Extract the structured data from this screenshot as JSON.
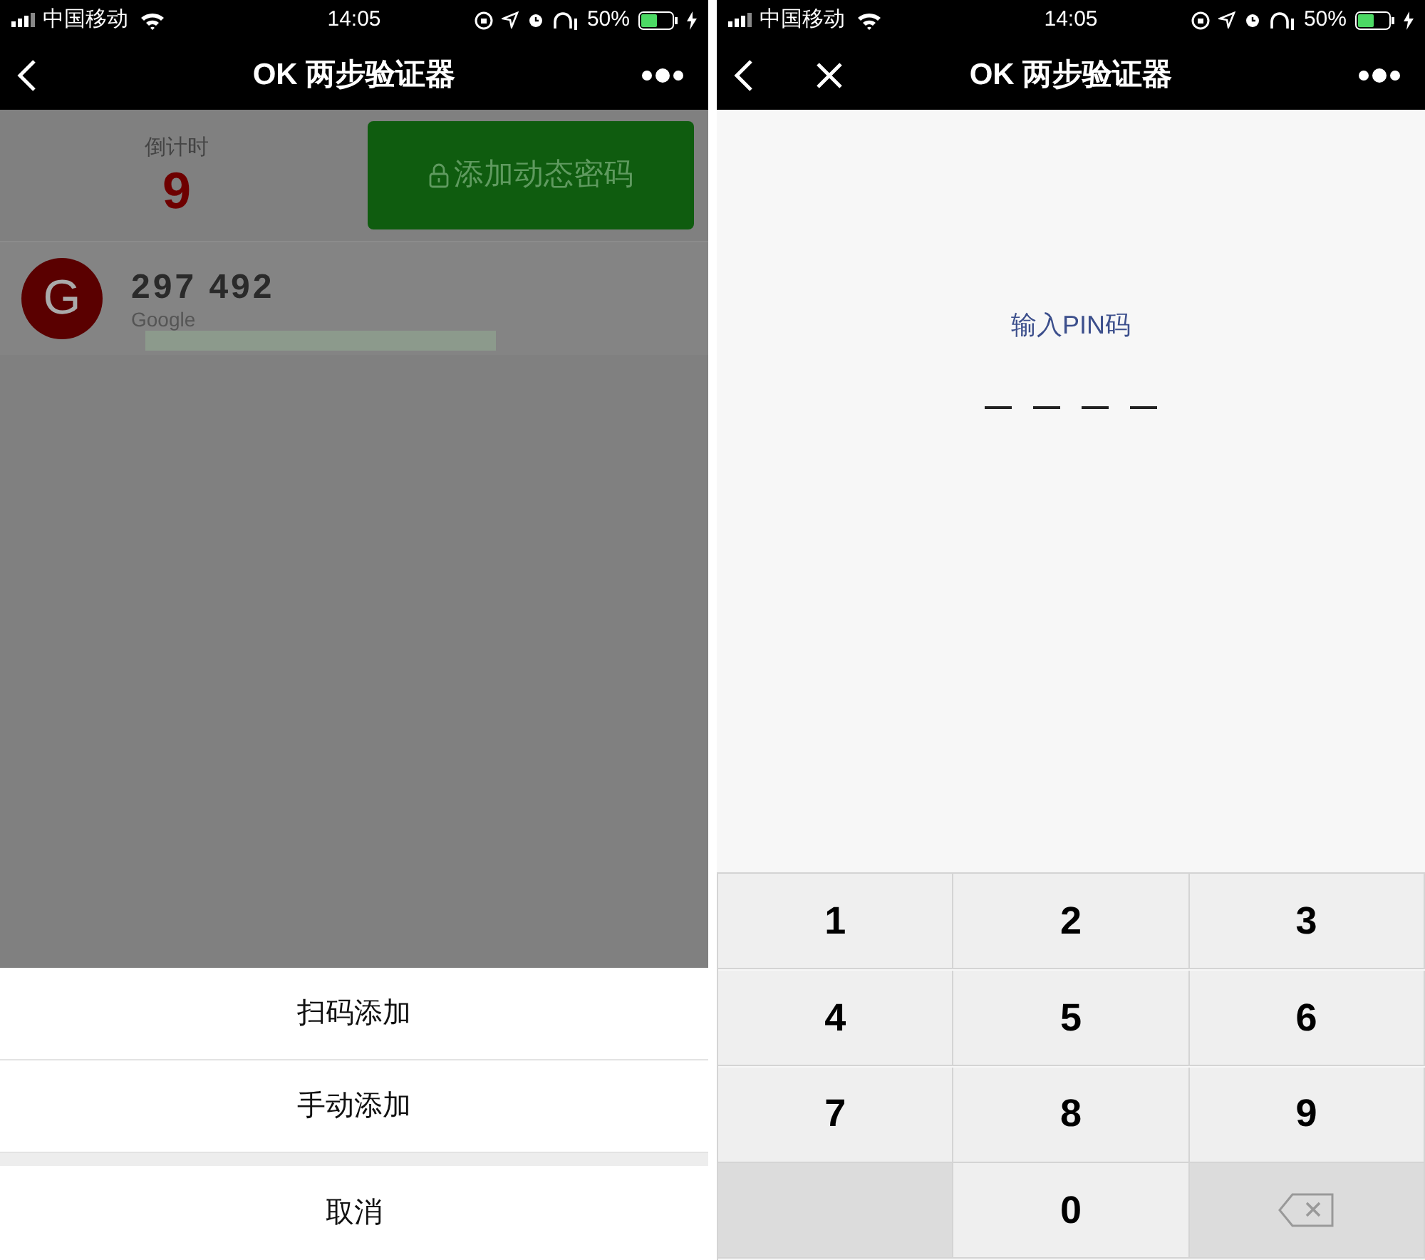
{
  "left": {
    "status_bar": {
      "carrier": "中国移动",
      "time": "14:05",
      "battery": "50%"
    },
    "nav": {
      "title": "OK 两步验证器",
      "close": false
    },
    "countdown": {
      "label": "倒计时",
      "value": "9"
    },
    "add_button": {
      "label": "添加动态密码"
    },
    "accounts": [
      {
        "initial": "G",
        "code": "297 492",
        "name": "Google"
      }
    ],
    "action_sheet": {
      "items": [
        "扫码添加",
        "手动添加"
      ],
      "cancel": "取消"
    }
  },
  "right": {
    "status_bar": {
      "carrier": "中国移动",
      "time": "14:05",
      "battery": "50%"
    },
    "nav": {
      "title": "OK 两步验证器",
      "close": true
    },
    "pin": {
      "prompt": "输入PIN码",
      "slots": [
        {
          "filled": false
        },
        {
          "filled": false
        },
        {
          "filled": false
        },
        {
          "filled": false
        }
      ]
    },
    "keypad": [
      {
        "kind": "digit",
        "label": "1"
      },
      {
        "kind": "digit",
        "label": "2"
      },
      {
        "kind": "digit",
        "label": "3"
      },
      {
        "kind": "digit",
        "label": "4"
      },
      {
        "kind": "digit",
        "label": "5"
      },
      {
        "kind": "digit",
        "label": "6"
      },
      {
        "kind": "digit",
        "label": "7"
      },
      {
        "kind": "digit",
        "label": "8"
      },
      {
        "kind": "digit",
        "label": "9"
      },
      {
        "kind": "blank"
      },
      {
        "kind": "digit",
        "label": "0"
      },
      {
        "kind": "backspace"
      }
    ]
  }
}
